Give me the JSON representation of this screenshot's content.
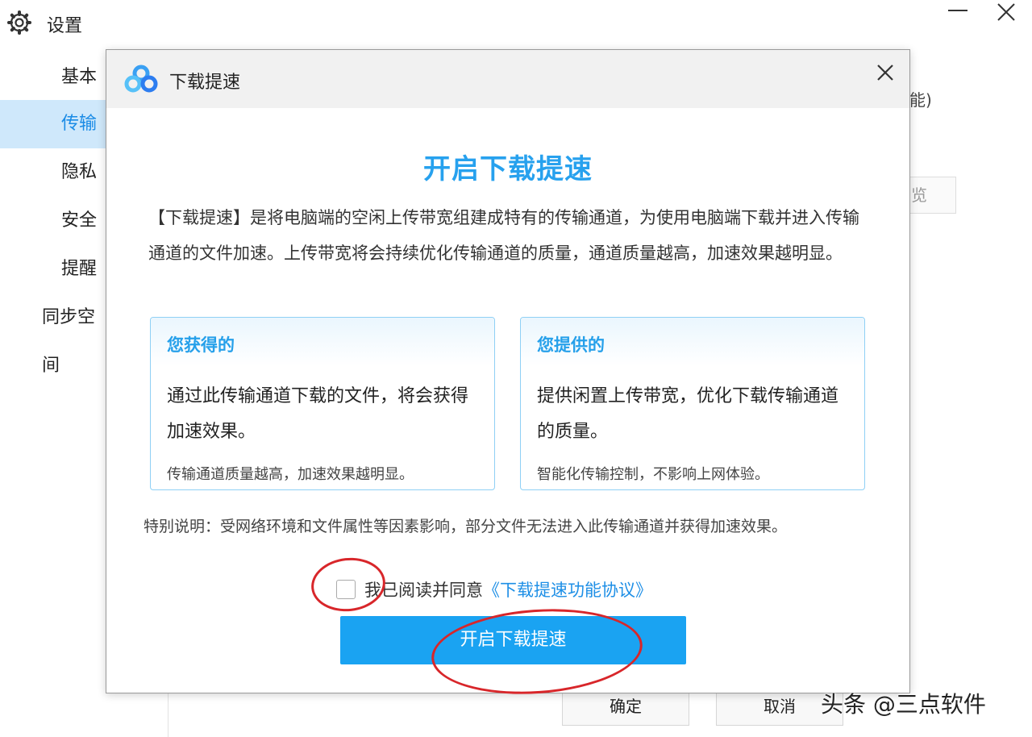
{
  "settings": {
    "title": "设置",
    "sidebar": [
      {
        "label": "基本",
        "active": false
      },
      {
        "label": "传输",
        "active": true
      },
      {
        "label": "隐私",
        "active": false
      },
      {
        "label": "安全",
        "active": false
      },
      {
        "label": "提醒",
        "active": false
      },
      {
        "label": "同步空间",
        "active": false
      }
    ],
    "right_fragment_text": "能)",
    "right_fragment_button": "览",
    "footer": {
      "ok": "确定",
      "cancel": "取消"
    }
  },
  "dialog": {
    "title": "下载提速",
    "heading": "开启下载提速",
    "description": "【下载提速】是将电脑端的空闲上传带宽组建成特有的传输通道，为使用电脑端下载并进入传输通道的文件加速。上传带宽将会持续优化传输通道的质量，通道质量越高，加速效果越明显。",
    "cards": {
      "gain": {
        "title": "您获得的",
        "body": "通过此传输通道下载的文件，将会获得加速效果。",
        "footnote": "传输通道质量越高，加速效果越明显。"
      },
      "provide": {
        "title": "您提供的",
        "body": "提供闲置上传带宽，优化下载传输通道的质量。",
        "footnote": "智能化传输控制，不影响上网体验。"
      }
    },
    "note": "特别说明：受网络环境和文件属性等因素影响，部分文件无法进入此传输通道并获得加速效果。",
    "agree_text": "我已阅读并同意",
    "agreement_link": "《下载提速功能协议》",
    "agree_checked": false,
    "enable_button": "开启下载提速"
  },
  "watermark": "头条 @三点软件",
  "colors": {
    "accent": "#1aa3f2",
    "heading": "#27a1ee",
    "annotation": "#d8262a",
    "active_sidebar_bg": "#cfe8fb"
  }
}
